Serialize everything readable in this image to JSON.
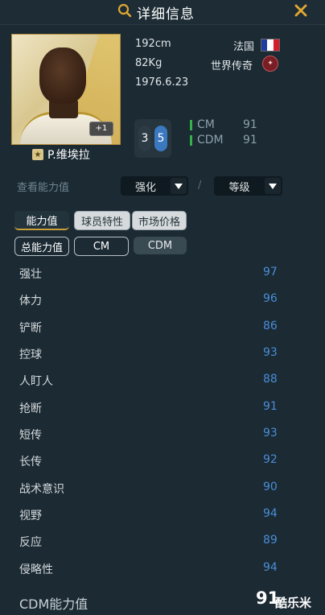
{
  "header": {
    "title": "详细信息"
  },
  "player": {
    "name": "P.维埃拉",
    "height": "192cm",
    "weight": "82Kg",
    "birthdate": "1976.6.23",
    "nation": "法国",
    "season": "世界传奇",
    "card_badge": "+1",
    "position_digits": [
      "3",
      "5"
    ],
    "positions": [
      {
        "name": "CM",
        "rating": "91"
      },
      {
        "name": "CDM",
        "rating": "91"
      }
    ]
  },
  "controls": {
    "view_label": "查看能力值",
    "enhance": "强化",
    "slash": "/",
    "level": "等级"
  },
  "tabs": [
    "能力值",
    "球员特性",
    "市场价格"
  ],
  "subtabs": [
    "总能力值",
    "CM",
    "CDM"
  ],
  "stats": [
    {
      "name": "强壮",
      "value": "97"
    },
    {
      "name": "体力",
      "value": "96"
    },
    {
      "name": "铲断",
      "value": "86"
    },
    {
      "name": "控球",
      "value": "93"
    },
    {
      "name": "人盯人",
      "value": "88"
    },
    {
      "name": "抢断",
      "value": "91"
    },
    {
      "name": "短传",
      "value": "93"
    },
    {
      "name": "长传",
      "value": "92"
    },
    {
      "name": "战术意识",
      "value": "90"
    },
    {
      "name": "视野",
      "value": "94"
    },
    {
      "name": "反应",
      "value": "89"
    },
    {
      "name": "侵略性",
      "value": "94"
    }
  ],
  "footer": {
    "label": "CDM能力值",
    "value": "91",
    "watermark": "酷乐米"
  },
  "colors": {
    "accent": "#e0a733",
    "stat_value": "#4a8ed8",
    "background": "#1b2a33"
  },
  "icons": {
    "search": "search-icon",
    "close": "close-icon",
    "dropdown": "chevron-down-icon"
  }
}
